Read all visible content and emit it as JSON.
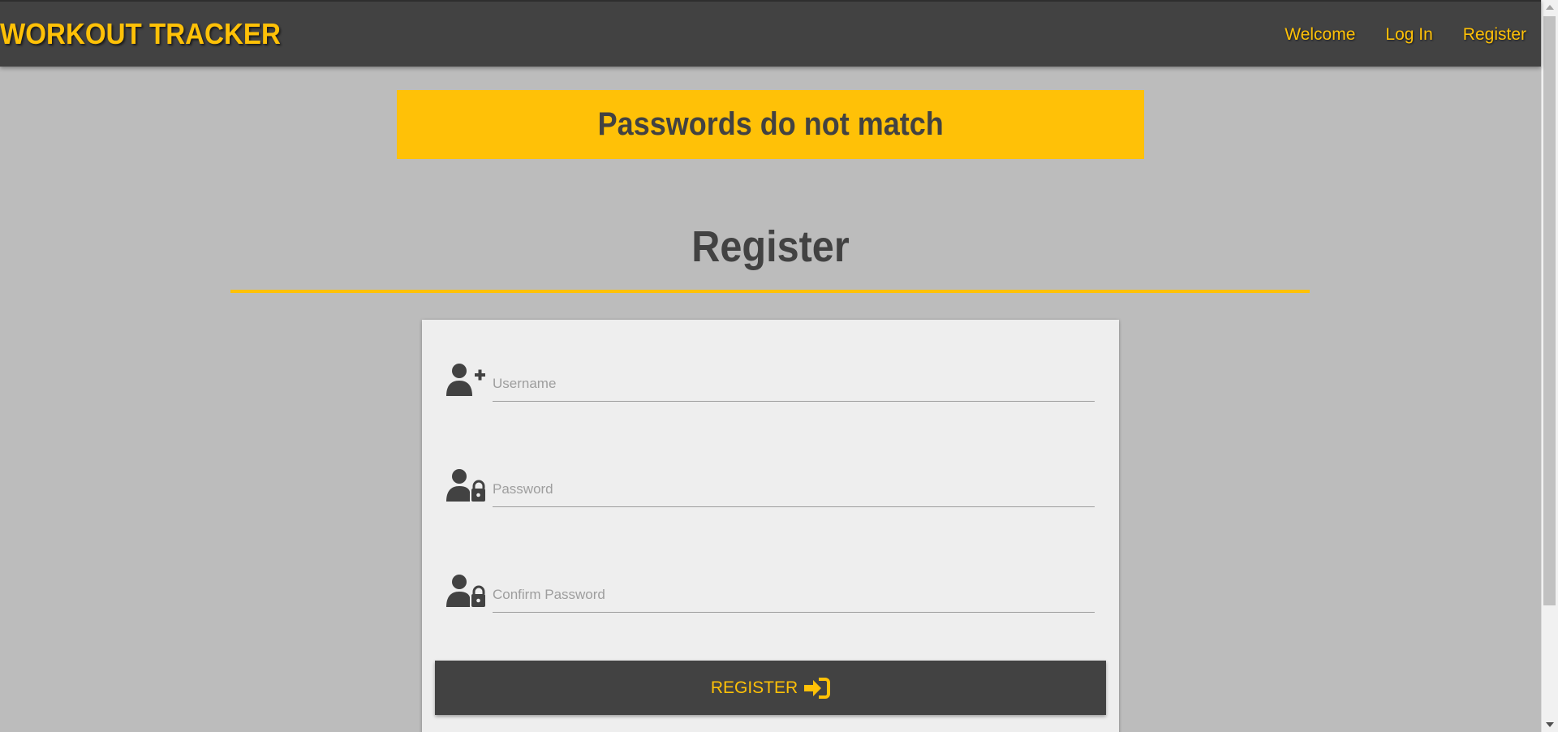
{
  "navbar": {
    "brand": "WORKOUT TRACKER",
    "links": [
      {
        "label": "Welcome"
      },
      {
        "label": "Log In"
      },
      {
        "label": "Register"
      }
    ]
  },
  "alert": {
    "message": "Passwords do not match"
  },
  "page": {
    "title": "Register"
  },
  "form": {
    "username": {
      "placeholder": "Username",
      "value": "",
      "icon": "user-plus-icon"
    },
    "password": {
      "placeholder": "Password",
      "value": "",
      "icon": "user-lock-icon"
    },
    "confirm_password": {
      "placeholder": "Confirm Password",
      "value": "",
      "icon": "user-lock-icon"
    },
    "submit_label": "REGISTER",
    "submit_icon": "sign-in-icon"
  },
  "colors": {
    "accent": "#ffc107",
    "dark": "#424242",
    "background": "#bcbcbc",
    "card": "#eeeeee"
  }
}
